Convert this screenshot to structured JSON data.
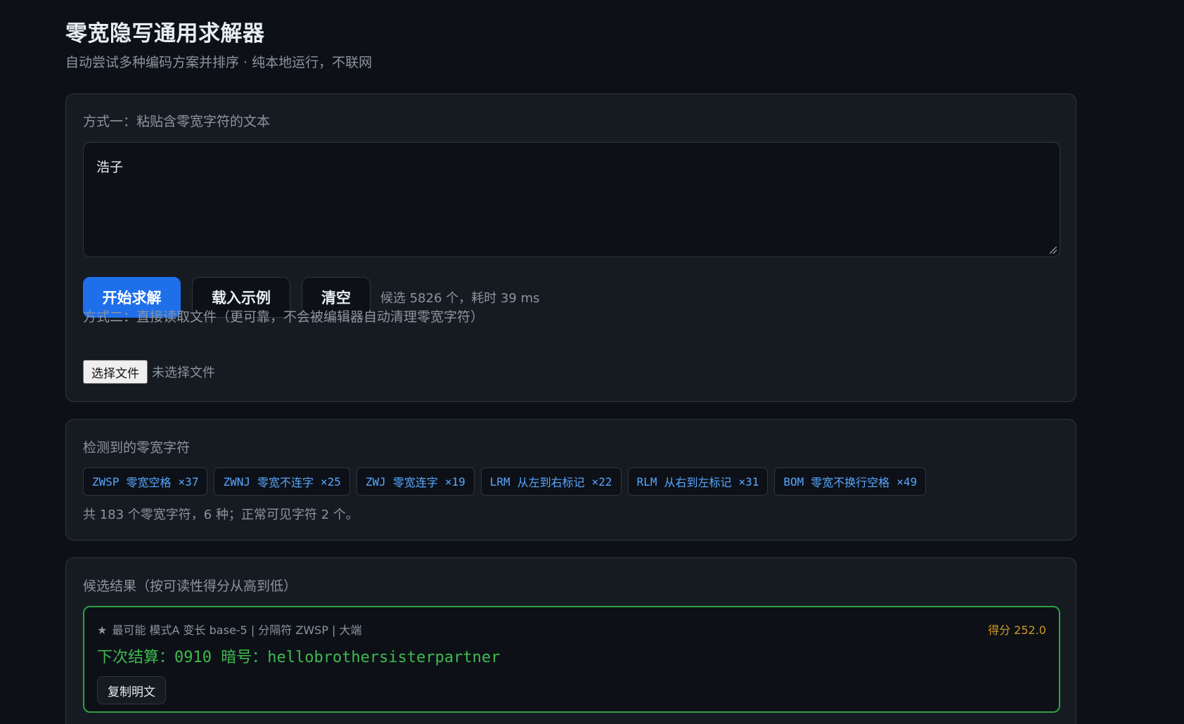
{
  "header": {
    "title": "零宽隐写通用求解器",
    "subtitle": "自动尝试多种编码方案并排序 · 纯本地运行，不联网"
  },
  "input_section": {
    "label": "方式一：粘贴含零宽字符的文本",
    "textarea_value": "浩子",
    "buttons": {
      "solve": "开始求解",
      "load_example": "载入示例",
      "clear": "清空"
    },
    "status": "候选 5826 个，耗时 39 ms",
    "file_label": "方式二：直接读取文件（更可靠，不会被编辑器自动清理零宽字符）",
    "file_button": "选择文件",
    "file_status": "未选择文件"
  },
  "detect_section": {
    "label": "检测到的零宽字符",
    "chips": [
      {
        "code": "ZWSP",
        "name": "零宽空格",
        "count": "×37"
      },
      {
        "code": "ZWNJ",
        "name": "零宽不连字",
        "count": "×25"
      },
      {
        "code": "ZWJ",
        "name": "零宽连字",
        "count": "×19"
      },
      {
        "code": "LRM",
        "name": "从左到右标记",
        "count": "×22"
      },
      {
        "code": "RLM",
        "name": "从右到左标记",
        "count": "×31"
      },
      {
        "code": "BOM",
        "name": "零宽不换行空格",
        "count": "×49"
      }
    ],
    "summary": "共 183 个零宽字符，6 种；正常可见字符 2 个。"
  },
  "results_section": {
    "label": "候选结果（按可读性得分从高到低）",
    "results": [
      {
        "meta": "最可能 模式A 变长 base-5 | 分隔符 ZWSP | 大端",
        "score": "得分 252.0",
        "plaintext": "下次结算：0910 暗号：hellobrothersisterpartner",
        "copy_label": "复制明文"
      }
    ]
  },
  "colors": {
    "background": "#0d1117",
    "card": "#161b22",
    "border": "#30363d",
    "accent": "#1f6feb",
    "chip_text": "#58a6ff",
    "success": "#3fb950",
    "score": "#d29922"
  }
}
